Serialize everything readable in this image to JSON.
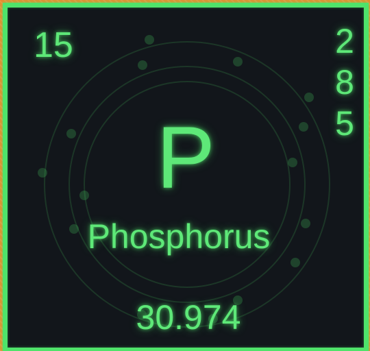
{
  "element": {
    "atomic_number": "15",
    "symbol": "P",
    "name": "Phosphorus",
    "atomic_mass": "30.974",
    "shells": [
      "2",
      "8",
      "5"
    ]
  },
  "colors": {
    "background": "#ef8a2c",
    "tile": "#12161b",
    "accent": "#4fe36a"
  }
}
